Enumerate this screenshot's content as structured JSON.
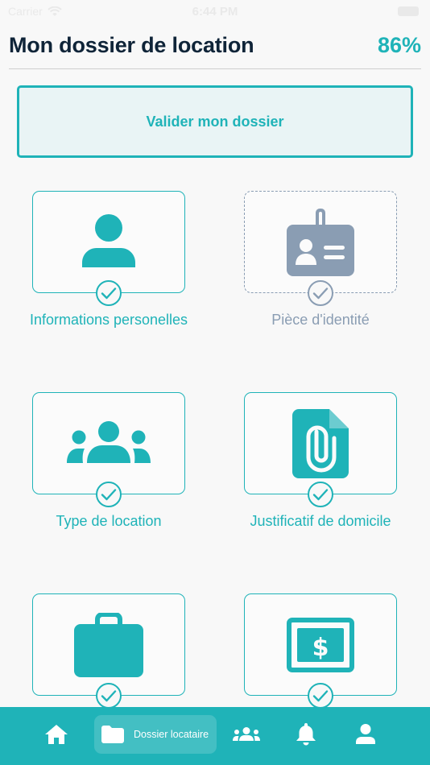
{
  "status_bar": {
    "carrier": "Carrier",
    "time": "6:44 PM"
  },
  "header": {
    "title": "Mon dossier de location",
    "progress": "86%"
  },
  "validate_button": {
    "label": "Valider mon dossier"
  },
  "cards": [
    {
      "label": "Informations personelles",
      "icon": "user-icon",
      "state": "complete"
    },
    {
      "label": "Pièce d'identité",
      "icon": "id-badge-icon",
      "state": "pending"
    },
    {
      "label": "Type de location",
      "icon": "users-icon",
      "state": "complete"
    },
    {
      "label": "Justificatif de domicile",
      "icon": "file-attachment-icon",
      "state": "complete"
    },
    {
      "label": "",
      "icon": "briefcase-icon",
      "state": "complete"
    },
    {
      "label": "",
      "icon": "money-bill-icon",
      "state": "complete"
    }
  ],
  "tabbar": {
    "tabs": [
      {
        "name": "home",
        "icon": "home-icon"
      },
      {
        "name": "dossier",
        "icon": "folder-icon",
        "label": "Dossier locataire",
        "active": true
      },
      {
        "name": "groups",
        "icon": "users-icon"
      },
      {
        "name": "notifications",
        "icon": "bell-icon"
      },
      {
        "name": "profile",
        "icon": "user-icon"
      }
    ]
  },
  "colors": {
    "accent": "#1fb3b8",
    "title": "#0f2438",
    "muted": "#8a9db3",
    "button_bg": "#e9f4f5"
  }
}
